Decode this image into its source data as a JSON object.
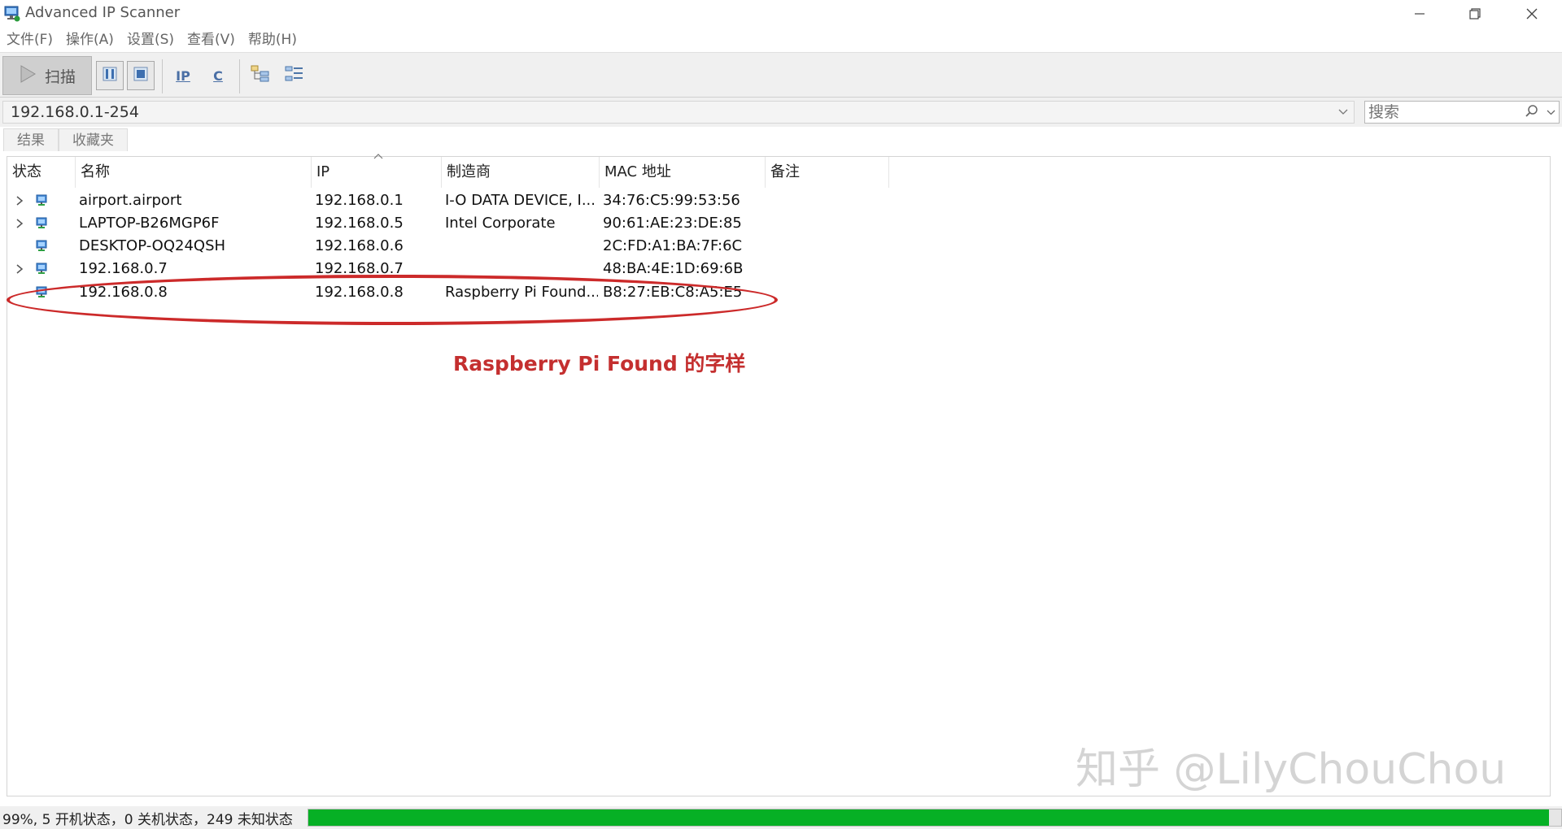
{
  "window": {
    "title": "Advanced IP Scanner"
  },
  "menu": [
    "文件(F)",
    "操作(A)",
    "设置(S)",
    "查看(V)",
    "帮助(H)"
  ],
  "toolbar": {
    "scan_label": "扫描",
    "ip_label": "IP",
    "c_label": "C"
  },
  "address": {
    "range_value": "192.168.0.1-254",
    "search_placeholder": "搜索"
  },
  "tabs": [
    "结果",
    "收藏夹"
  ],
  "table": {
    "columns": [
      "状态",
      "名称",
      "IP",
      "制造商",
      "MAC 地址",
      "备注"
    ],
    "rows": [
      {
        "expandable": true,
        "name": "airport.airport",
        "ip": "192.168.0.1",
        "maker": "I-O DATA DEVICE, I...",
        "mac": "34:76:C5:99:53:56",
        "note": ""
      },
      {
        "expandable": true,
        "name": "LAPTOP-B26MGP6F",
        "ip": "192.168.0.5",
        "maker": "Intel Corporate",
        "mac": "90:61:AE:23:DE:85",
        "note": ""
      },
      {
        "expandable": false,
        "name": "DESKTOP-OQ24QSH",
        "ip": "192.168.0.6",
        "maker": "",
        "mac": "2C:FD:A1:BA:7F:6C",
        "note": ""
      },
      {
        "expandable": true,
        "name": "192.168.0.7",
        "ip": "192.168.0.7",
        "maker": "",
        "mac": "48:BA:4E:1D:69:6B",
        "note": ""
      },
      {
        "expandable": false,
        "name": "192.168.0.8",
        "ip": "192.168.0.8",
        "maker": "Raspberry Pi Found...",
        "mac": "B8:27:EB:C8:A5:E5",
        "note": ""
      }
    ]
  },
  "annotation": {
    "text": "Raspberry Pi Found 的字样",
    "color": "#c42f2f"
  },
  "watermark": "知乎 @LilyChouChou",
  "status": {
    "text": "99%, 5 开机状态，0 关机状态，249 未知状态",
    "progress": 0.99,
    "progress_color": "#06b025"
  }
}
